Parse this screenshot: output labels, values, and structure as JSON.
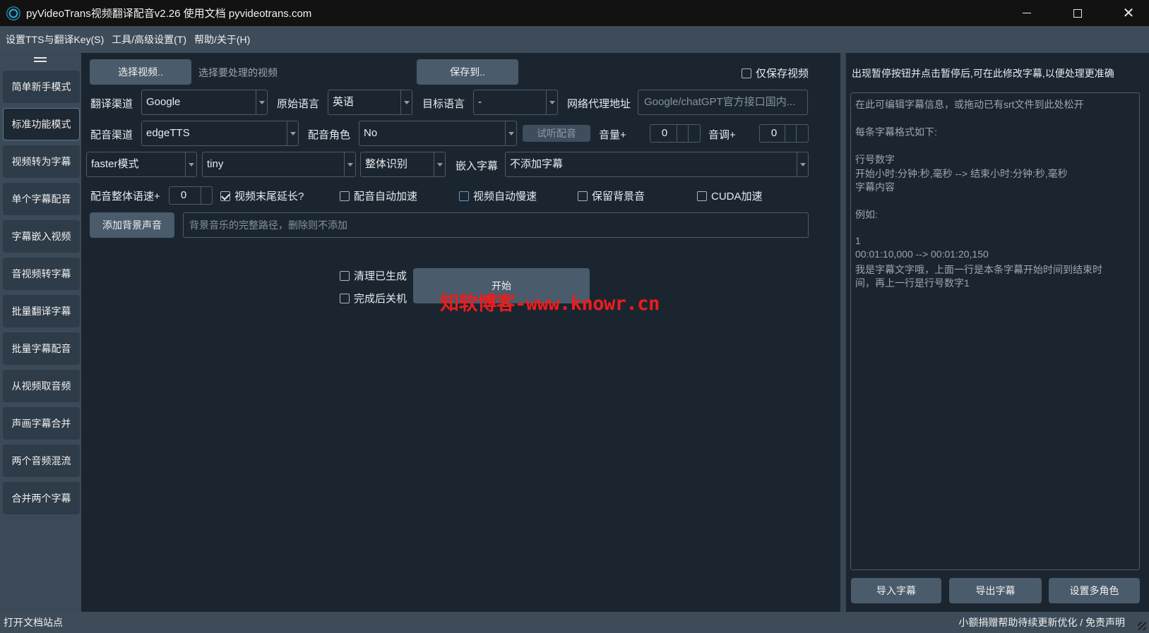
{
  "window": {
    "title": "pyVideoTrans视频翻译配音v2.26  使用文档  pyvideotrans.com",
    "minimize": "minimize-icon",
    "maximize": "maximize-icon",
    "close": "close-icon"
  },
  "menu": [
    "设置TTS与翻译Key(S)",
    "工具/高级设置(T)",
    "帮助/关于(H)"
  ],
  "sidebar": {
    "items": [
      "简单新手模式",
      "标准功能模式",
      "视频转为字幕",
      "单个字幕配音",
      "字幕嵌入视频",
      "音视频转字幕",
      "批量翻译字幕",
      "批量字幕配音",
      "从视频取音频",
      "声画字幕合并",
      "两个音频混流",
      "合并两个字幕"
    ],
    "active_index": 1
  },
  "toolbar": {
    "select_video": "选择视频..",
    "select_hint": "选择要处理的视频",
    "save_to": "保存到..",
    "only_save_video": "仅保存视频",
    "only_save_video_checked": false
  },
  "row1": {
    "translate_label": "翻译渠道",
    "translate_value": "Google",
    "source_label": "原始语言",
    "source_value": "英语",
    "target_label": "目标语言",
    "target_value": "-",
    "proxy_label": "网络代理地址",
    "proxy_placeholder": "Google/chatGPT官方接口国内..."
  },
  "row2": {
    "dub_label": "配音渠道",
    "dub_value": "edgeTTS",
    "role_label": "配音角色",
    "role_value": "No",
    "preview_button": "试听配音",
    "volume_label": "音量+",
    "volume_value": "0",
    "pitch_label": "音调+",
    "pitch_value": "0"
  },
  "row3": {
    "mode_value": "faster模式",
    "model_value": "tiny",
    "recog_value": "整体识别",
    "embed_label": "嵌入字幕",
    "embed_value": "不添加字幕"
  },
  "row4": {
    "speed_label": "配音整体语速+",
    "speed_value": "0",
    "checks": [
      {
        "label": "视频末尾延长?",
        "checked": true
      },
      {
        "label": "配音自动加速",
        "checked": false
      },
      {
        "label": "视频自动慢速",
        "checked": false
      },
      {
        "label": "保留背景音",
        "checked": false
      },
      {
        "label": "CUDA加速",
        "checked": false
      }
    ]
  },
  "row5": {
    "bg_button": "添加背景声音",
    "bg_placeholder": "背景音乐的完整路径，删除则不添加"
  },
  "actions": {
    "clear_generated": "清理已生成",
    "shutdown_after": "完成后关机",
    "start_button": "开始"
  },
  "watermark": "知软博客-www.knowr.cn",
  "right_panel": {
    "hint": "出现暂停按钮并点击暂停后,可在此修改字幕,以便处理更准确",
    "editor_lines": [
      " 在此可编辑字幕信息，或拖动已有srt文件到此处松开",
      "",
      "每条字幕格式如下:",
      "",
      "行号数字",
      "开始小时:分钟:秒,毫秒 --> 结束小时:分钟:秒,毫秒",
      "字幕内容",
      "",
      "例如:",
      "",
      "1",
      "00:01:10,000 --> 00:01:20,150",
      "我是字幕文字哦，上面一行是本条字幕开始时间到结束时",
      "间，再上一行是行号数字1"
    ],
    "import_button": "导入字幕",
    "export_button": "导出字幕",
    "roles_button": "设置多角色"
  },
  "status": {
    "left": "打开文档站点",
    "right": "小额捐赠帮助待续更新优化 / 免责声明"
  }
}
